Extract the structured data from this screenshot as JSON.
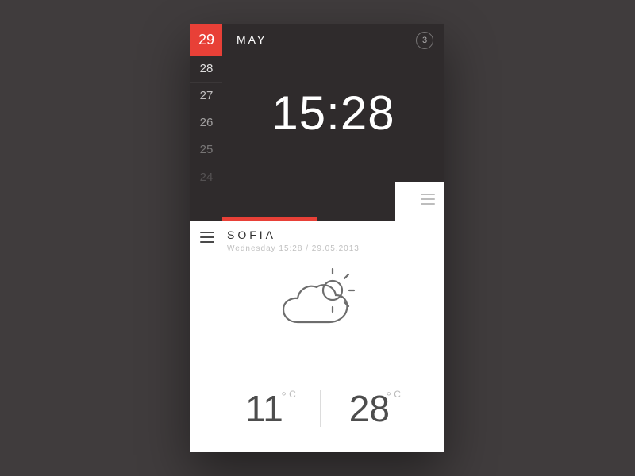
{
  "header": {
    "selected_day": "29",
    "month": "MAY",
    "badge_count": "3",
    "days": [
      "28",
      "27",
      "26",
      "25",
      "24"
    ]
  },
  "clock": {
    "time": "15:28"
  },
  "weather": {
    "city": "SOFIA",
    "subline": "Wednesday 15:28 / 29.05.2013",
    "low_temp": "11",
    "high_temp": "28",
    "unit": "C"
  }
}
